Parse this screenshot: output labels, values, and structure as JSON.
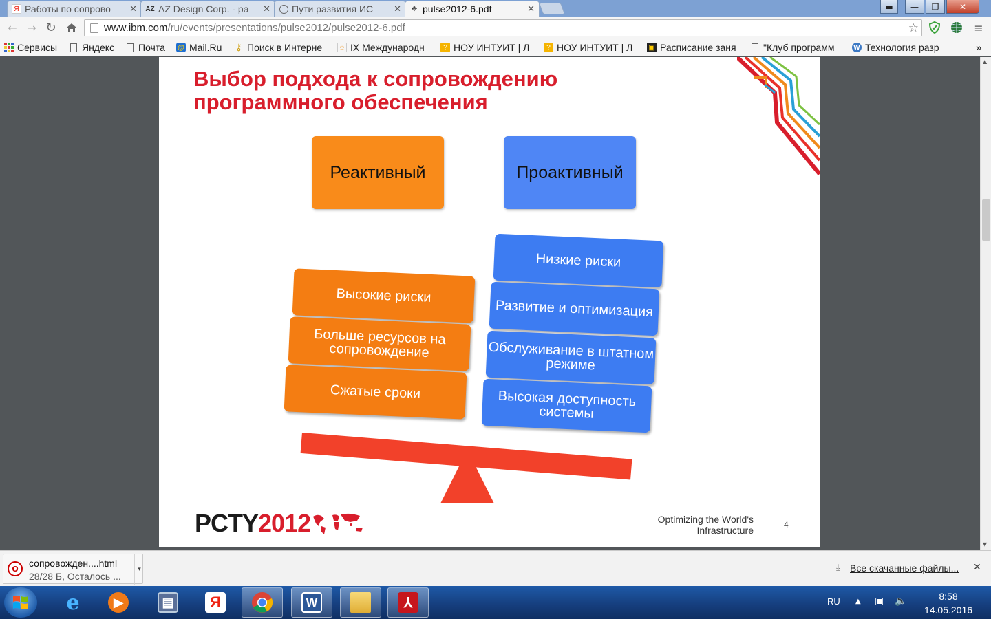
{
  "browser": {
    "tabs": [
      {
        "title": "Работы по сопрово",
        "favicon": "yandex-icon",
        "active": false
      },
      {
        "title": "AZ Design Corp. - ра",
        "favicon": "az-icon",
        "active": false
      },
      {
        "title": "Пути развития ИС",
        "favicon": "loading-icon",
        "active": false
      },
      {
        "title": "pulse2012-6.pdf",
        "favicon": "pdf-icon",
        "active": true
      }
    ],
    "close_glyph": "✕",
    "url_host": "www.ibm.com",
    "url_path": "/ru/events/presentations/pulse2012/pulse2012-6.pdf",
    "bookmarks": [
      {
        "label": "Сервисы",
        "icon": "apps-grid-icon"
      },
      {
        "label": "Яндекс",
        "icon": "page-icon"
      },
      {
        "label": "Почта",
        "icon": "page-icon"
      },
      {
        "label": "Mail.Ru",
        "icon": "mailru-icon"
      },
      {
        "label": "Поиск в Интерне",
        "icon": "search-key-icon"
      },
      {
        "label": "IX Международн",
        "icon": "conference-icon"
      },
      {
        "label": "НОУ ИНТУИТ | Л",
        "icon": "intuit-icon"
      },
      {
        "label": "НОУ ИНТУИТ | Л",
        "icon": "intuit-icon"
      },
      {
        "label": "Расписание заня",
        "icon": "schedule-icon"
      },
      {
        "label": "\"Клуб программ",
        "icon": "page-icon"
      },
      {
        "label": "Технология разр",
        "icon": "wordpress-icon"
      }
    ],
    "bookmarks_overflow": "»"
  },
  "slide": {
    "title": "Выбор подхода к сопровождению программного обеспечения",
    "reactive_header": "Реактивный",
    "proactive_header": "Проактивный",
    "reactive_items": [
      "Высокие риски",
      "Больше ресурсов на сопровождение",
      "Сжатые сроки"
    ],
    "proactive_items": [
      "Низкие риски",
      "Развитие и оптимизация",
      "Обслуживание в штатном режиме",
      "Высокая доступность системы"
    ],
    "logo_text": "PCTY",
    "logo_year": "2012",
    "tagline": "Optimizing the World's Infrastructure",
    "page_number": "4",
    "colors": {
      "title": "#d81e2c",
      "orange": "#f47d12",
      "blue": "#3d7cf2",
      "beam": "#f2412a"
    }
  },
  "downloads": {
    "file_name": "сопровожден....html",
    "status": "28/28 Б, Осталось ...",
    "all_downloads": "Все скачанные файлы...",
    "close_glyph": "✕"
  },
  "taskbar": {
    "apps": [
      "internet-explorer-icon",
      "media-player-icon",
      "security-icon",
      "yandex-browser-icon",
      "chrome-icon",
      "word-icon",
      "explorer-folder-icon",
      "acrobat-icon"
    ],
    "language": "RU",
    "time": "8:58",
    "date": "14.05.2016"
  }
}
